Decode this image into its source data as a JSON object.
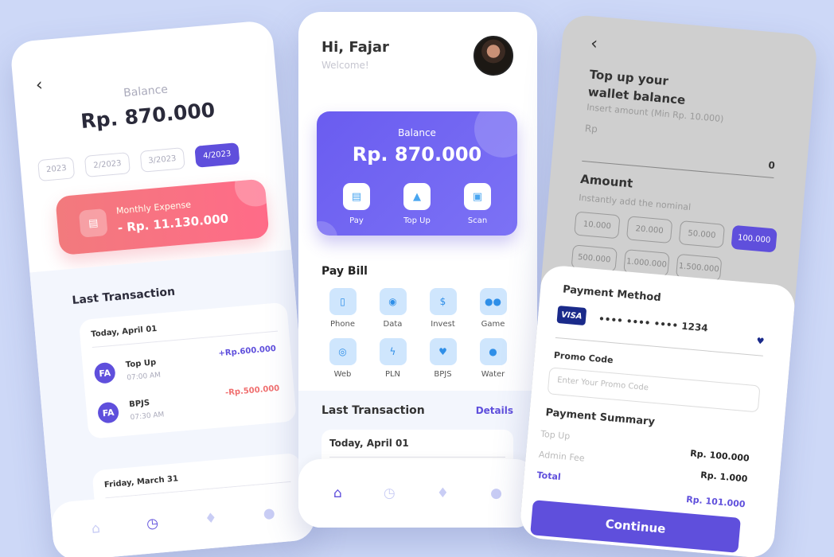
{
  "left_screen": {
    "balance_label": "Balance",
    "balance_value": "Rp. 870.000",
    "months": [
      {
        "label": "2023",
        "active": false
      },
      {
        "label": "2/2023",
        "active": false
      },
      {
        "label": "3/2023",
        "active": false
      },
      {
        "label": "4/2023",
        "active": true
      }
    ],
    "expense": {
      "label": "Monthly Expense",
      "amount": "- Rp. 11.130.000"
    },
    "last_transaction_title": "Last Transaction",
    "groups": [
      {
        "date": "Today, April 01",
        "items": [
          {
            "initials": "FA",
            "name": "Top Up",
            "time": "07:00 AM",
            "amount": "+Rp.600.000",
            "color": "#5f4fdc"
          },
          {
            "initials": "FA",
            "name": "BPJS",
            "time": "07:30 AM",
            "amount": "-Rp.500.000",
            "color": "#f07070"
          }
        ]
      },
      {
        "date": "Friday, March 31",
        "items": []
      }
    ],
    "nav": [
      "home-icon",
      "history-icon",
      "bell-icon",
      "user-icon"
    ]
  },
  "middle_screen": {
    "greeting": "Hi, Fajar",
    "welcome": "Welcome!",
    "balance_label": "Balance",
    "balance_value": "Rp. 870.000",
    "actions": [
      {
        "label": "Pay",
        "icon": "wallet-icon"
      },
      {
        "label": "Top Up",
        "icon": "topup-icon"
      },
      {
        "label": "Scan",
        "icon": "scan-icon"
      }
    ],
    "pay_bill_title": "Pay Bill",
    "bills": [
      {
        "label": "Phone",
        "icon": "phone-icon"
      },
      {
        "label": "Data",
        "icon": "wifi-icon"
      },
      {
        "label": "Invest",
        "icon": "invest-icon"
      },
      {
        "label": "Game",
        "icon": "game-icon"
      },
      {
        "label": "Web",
        "icon": "globe-icon"
      },
      {
        "label": "PLN",
        "icon": "lightning-icon"
      },
      {
        "label": "BPJS",
        "icon": "health-icon"
      },
      {
        "label": "Water",
        "icon": "water-icon"
      }
    ],
    "last_transaction_title": "Last Transaction",
    "details_link": "Details",
    "first_date": "Today, April 01"
  },
  "right_screen": {
    "title_line1": "Top up your",
    "title_line2": "wallet balance",
    "subtitle": "Insert amount (Min Rp. 10.000)",
    "currency": "Rp",
    "amount_value": "0",
    "amount_title": "Amount",
    "amount_subtitle": "Instantly add the nominal",
    "chips": [
      {
        "label": "10.000",
        "active": false
      },
      {
        "label": "20.000",
        "active": false
      },
      {
        "label": "50.000",
        "active": false
      },
      {
        "label": "100.000",
        "active": true
      },
      {
        "label": "500.000",
        "active": false
      },
      {
        "label": "1.000.000",
        "active": false
      },
      {
        "label": "1.500.000",
        "active": false
      }
    ],
    "payment_method_title": "Payment Method",
    "card_brand": "VISA",
    "card_number": "•••• •••• •••• 1234",
    "promo_label": "Promo Code",
    "promo_placeholder": "Enter Your Promo Code",
    "summary_title": "Payment Summary",
    "summary": [
      {
        "label": "Top Up",
        "value": "Rp. 100.000"
      },
      {
        "label": "Admin Fee",
        "value": "Rp. 1.000"
      },
      {
        "label": "Total",
        "value": "Rp. 101.000"
      }
    ],
    "continue_label": "Continue"
  },
  "colors": {
    "accent": "#5f4fdc",
    "expense": "#f7747f",
    "background": "#cdd8f7"
  }
}
